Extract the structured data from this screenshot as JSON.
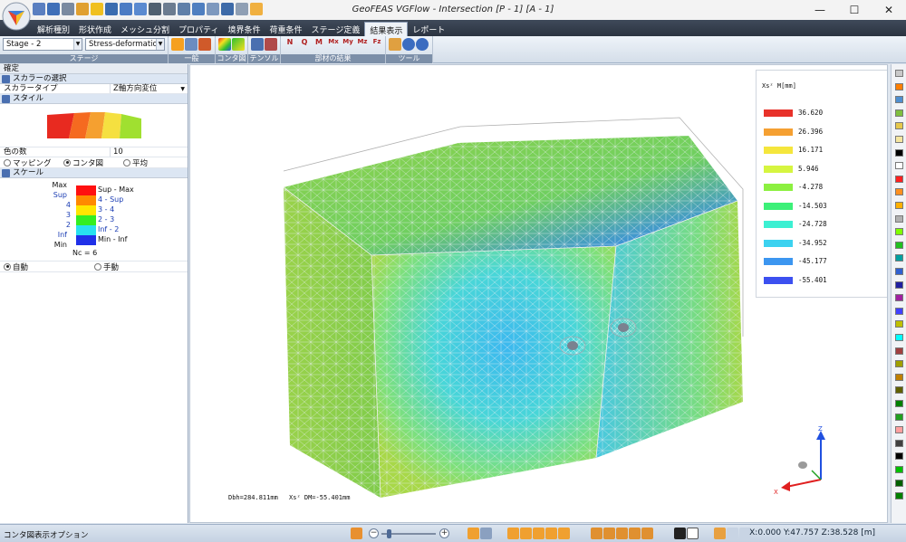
{
  "title": "GeoFEAS VGFlow - Intersection [P - 1] [A - 1]",
  "window_controls": {
    "minimize": "—",
    "maximize": "☐",
    "close": "✕"
  },
  "tabs": [
    "解析種別",
    "形状作成",
    "メッシュ分割",
    "プロパティ",
    "境界条件",
    "荷重条件",
    "ステージ定義",
    "結果表示",
    "レポート"
  ],
  "active_tab": "結果表示",
  "ribbon": {
    "stage_combo": "Stage - 2",
    "result_combo": "Stress-deformation",
    "group_labels": [
      "ステージ",
      "一般",
      "コンタ図",
      "テンソル",
      "部材の結果",
      "ツール"
    ],
    "member_icons": [
      "N",
      "Q",
      "M",
      "Mx",
      "My",
      "Mz",
      "Fz"
    ]
  },
  "left_panel": {
    "title": "確定",
    "section_scalar": "スカラーの選択",
    "scalar_type_label": "スカラータイプ",
    "scalar_type_value": "Z軸方向変位",
    "section_style": "スタイル",
    "num_colors_label": "色の数",
    "num_colors_value": "10",
    "radio_mapping": "マッピング",
    "radio_contour": "コンタ図",
    "radio_average": "平均",
    "section_scale": "スケール",
    "scale_left_labels": [
      "Max",
      "Sup",
      "4",
      "3",
      "2",
      "Inf",
      "Min"
    ],
    "scale_right_labels": [
      "Sup - Max",
      "4 - Sup",
      "3 - 4",
      "2 - 3",
      "Inf - 2",
      "Min - Inf"
    ],
    "scale_colors": [
      "#ff1010",
      "#ff8a00",
      "#ffe600",
      "#33ee22",
      "#28e0f0",
      "#2030e8"
    ],
    "nc_label": "Nc = 6",
    "radio_auto": "自動",
    "radio_manual": "手動"
  },
  "legend": {
    "title": "Xsᶻ  M[mm]",
    "values": [
      "36.620",
      "26.396",
      "16.171",
      "5.946",
      "-4.278",
      "-14.503",
      "-24.728",
      "-34.952",
      "-45.177",
      "-55.401"
    ],
    "colors": [
      "#e8322a",
      "#f5a032",
      "#f5e63c",
      "#d6f540",
      "#8cf040",
      "#3cf078",
      "#3cf0d2",
      "#3cd2f0",
      "#3c96f0",
      "#3c50f0"
    ]
  },
  "viewport_readout": {
    "left": "Dbh=284.811mm",
    "right": "Xsᶻ DM=-55.401mm"
  },
  "axis": {
    "z": "Z",
    "x": "X"
  },
  "palette_colors": [
    "#c9c9c9",
    "#ff7f00",
    "#4f8fd0",
    "#7fbf3f",
    "#e6c84c",
    "#f5e6a0",
    "#000000",
    "#ffffff",
    "#ff2020",
    "#ff9020",
    "#ffb000",
    "#b0b0b0",
    "#7fff00",
    "#20c020",
    "#00a0a0",
    "#3060d0",
    "#2020a0",
    "#a020a0",
    "#4040ff",
    "#c0c000",
    "#00ffff",
    "#a04040",
    "#a0a000",
    "#c08000",
    "#606000",
    "#008000",
    "#20a020",
    "#ffa0a0",
    "#404040",
    "#000000",
    "#00c000",
    "#006000",
    "#008000"
  ],
  "status": {
    "left": "コンタ図表示オプション",
    "coords": "X:0.000 Y:47.757 Z:38.528 [m]"
  }
}
